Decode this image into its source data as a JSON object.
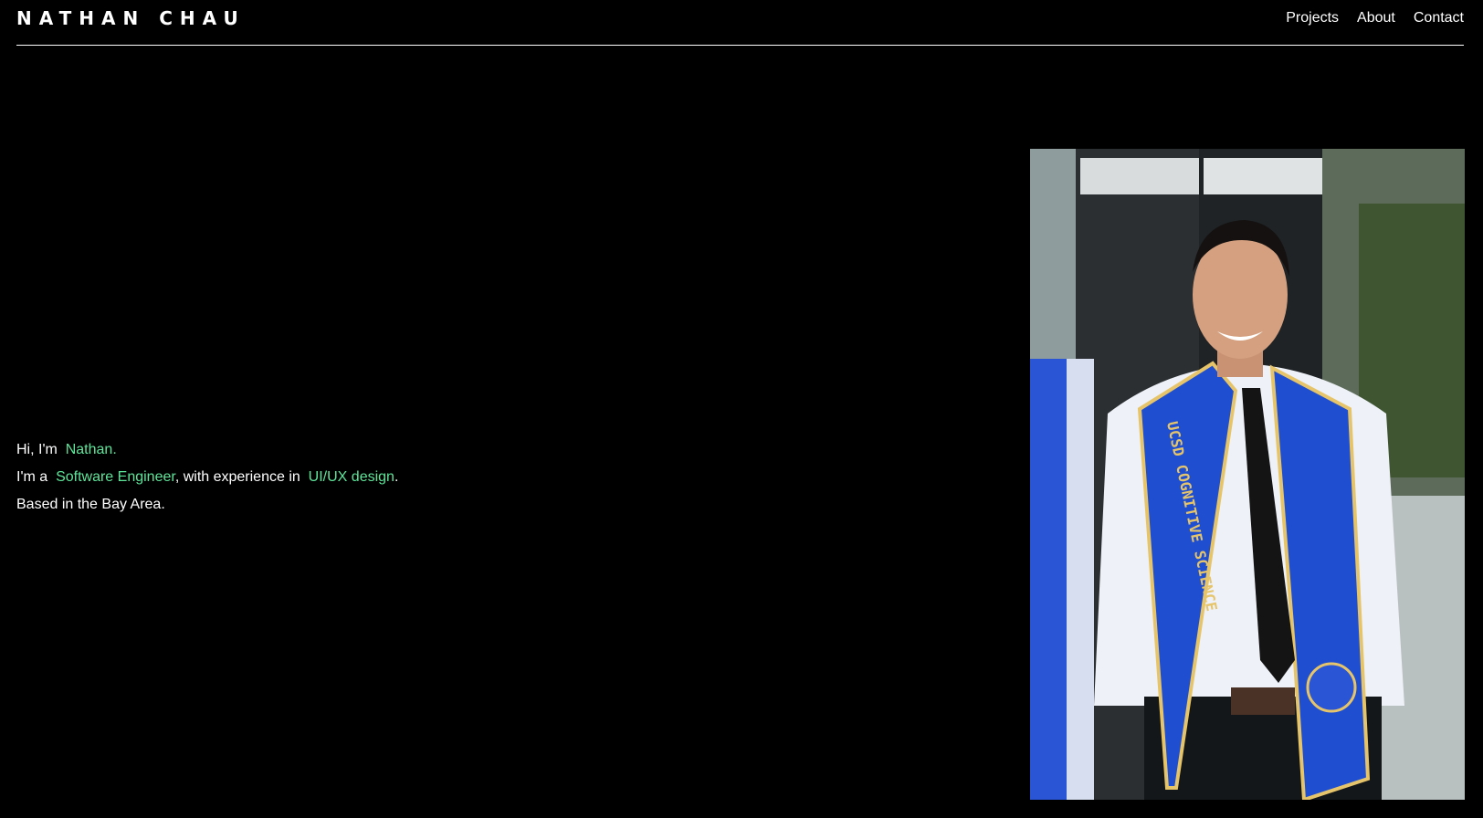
{
  "brand": {
    "name": "NATHAN CHAU"
  },
  "nav": {
    "items": [
      {
        "label": "Projects"
      },
      {
        "label": "About"
      },
      {
        "label": "Contact"
      }
    ]
  },
  "intro": {
    "line1_prefix": "Hi, I'm",
    "name": "Nathan.",
    "line2_prefix": "I'm a",
    "role": "Software Engineer",
    "line2_middle": ", with experience in",
    "skill": "UI/UX design",
    "line2_suffix": ".",
    "line3": "Based in the Bay Area."
  },
  "photo": {
    "stole_text": "UCSD COGNITIVE SCIENCE"
  },
  "colors": {
    "background": "#000000",
    "text": "#ffffff",
    "accent": "#5ee59a",
    "stole_blue": "#1f4fd0",
    "stole_gold": "#e6c46a"
  }
}
